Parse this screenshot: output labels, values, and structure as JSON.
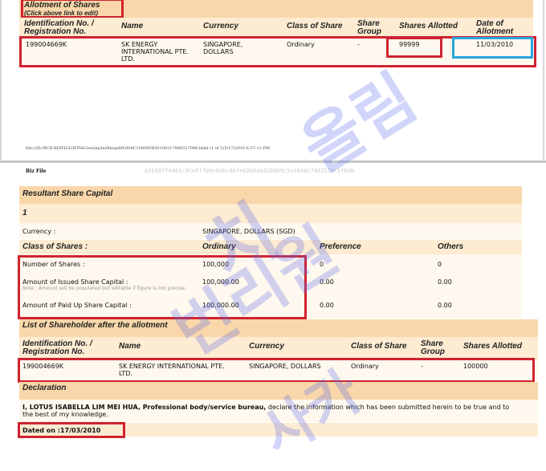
{
  "top_section": {
    "title": "Allotment of Shares",
    "note": "(Click above link to edit)",
    "headers": {
      "id": "Identification No. / Registration No.",
      "name": "Name",
      "currency": "Currency",
      "class": "Class of Share",
      "group": "Share Group",
      "allotted": "Shares Allotted",
      "date": "Date of Allotment"
    },
    "row": {
      "id": "199004669K",
      "name": "SK ENERGY INTERNATIONAL PTE. LTD.",
      "currency": "SINGAPORE, DOLLARS",
      "class": "Ordinary",
      "group": "-",
      "allotted": "99999",
      "date": "11/03/2010"
    }
  },
  "footer_line": "file:///D:/RCB-BIZFILE/HTMLGen/mybizfile/pdf/L008C100095B20100317060327006.html (1 of 2)3/17/2010 6:37:12 PM",
  "page2": {
    "brand": "Biz File",
    "hash": "a31507f4461c9ce5f700e3abc8bfeb2b8da429d89c5e1640c748317acbfbdb"
  },
  "resultant": {
    "title": "Resultant Share Capital",
    "index": "1",
    "currency_label": "Currency :",
    "currency_value": "SINGAPORE, DOLLARS (SGD)",
    "class_label": "Class of Shares :",
    "col_ordinary": "Ordinary",
    "col_preference": "Preference",
    "col_others": "Others",
    "rows": [
      {
        "label": "Number of Shares :",
        "note": "",
        "ordinary": "100,000",
        "preference": "0",
        "others": "0"
      },
      {
        "label": "Amount of Issued Share Capital :",
        "note": "Note : Amount will be populated but editable if figure is not precise.",
        "ordinary": "100,000.00",
        "preference": "0.00",
        "others": "0.00"
      },
      {
        "label": "Amount of Paid Up Share Capital :",
        "note": "",
        "ordinary": "100,000.00",
        "preference": "0.00",
        "others": "0.00"
      }
    ]
  },
  "shareholders": {
    "title": "List of Shareholder after the allotment",
    "headers": {
      "id": "Identification No. / Registration No.",
      "name": "Name",
      "currency": "Currency",
      "class": "Class of Share",
      "group": "Share Group",
      "allotted": "Shares Allotted"
    },
    "row": {
      "id": "199004669K",
      "name": "SK ENERGY INTERNATIONAL PTE. LTD.",
      "currency": "SINGAPORE, DOLLARS",
      "class": "Ordinary",
      "group": "-",
      "allotted": "100000"
    }
  },
  "declaration": {
    "title": "Declaration",
    "text_bold": "I, LOTUS ISABELLA LIM MEI HUA, Professional body/service bureau,",
    "text_rest": " declare the information which has been submitted herein to be true and to the best of my knowledge.",
    "dated": "Dated on :17/03/2010"
  },
  "watermark": {
    "word1": "올림",
    "word2": "치",
    "word3": "번리원",
    "word4": "사카"
  },
  "colors": {
    "red_box": "#d0232f",
    "blue_box": "#2ba6dd",
    "band": "#f9d7aa",
    "watermark": "#5a69eb"
  }
}
